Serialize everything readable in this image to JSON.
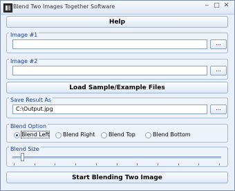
{
  "window": {
    "title": "Blend Two Images Together Software",
    "controls": [
      "minimize-icon",
      "maximize-icon",
      "close-icon"
    ]
  },
  "buttons": {
    "help": "Help",
    "load_sample": "Load Sample/Example Files",
    "start": "Start Blending Two Image"
  },
  "image1": {
    "label": "Image #1",
    "value": "",
    "browse": "..."
  },
  "image2": {
    "label": "Image #2",
    "value": "",
    "browse": "..."
  },
  "save": {
    "label": "Save Result As",
    "value": "C:\\Output.jpg",
    "browse": "..."
  },
  "blend_option": {
    "label": "Blend Option",
    "options": [
      "Blend Left",
      "Blend Right",
      "Blend Top",
      "Blend Bottom"
    ],
    "selected": "Blend Left"
  },
  "blend_size": {
    "label": "Blend Size",
    "value": 0.04
  },
  "colors": {
    "group_label": "#1e3e8c",
    "window_bg": "#e9f0fa"
  }
}
